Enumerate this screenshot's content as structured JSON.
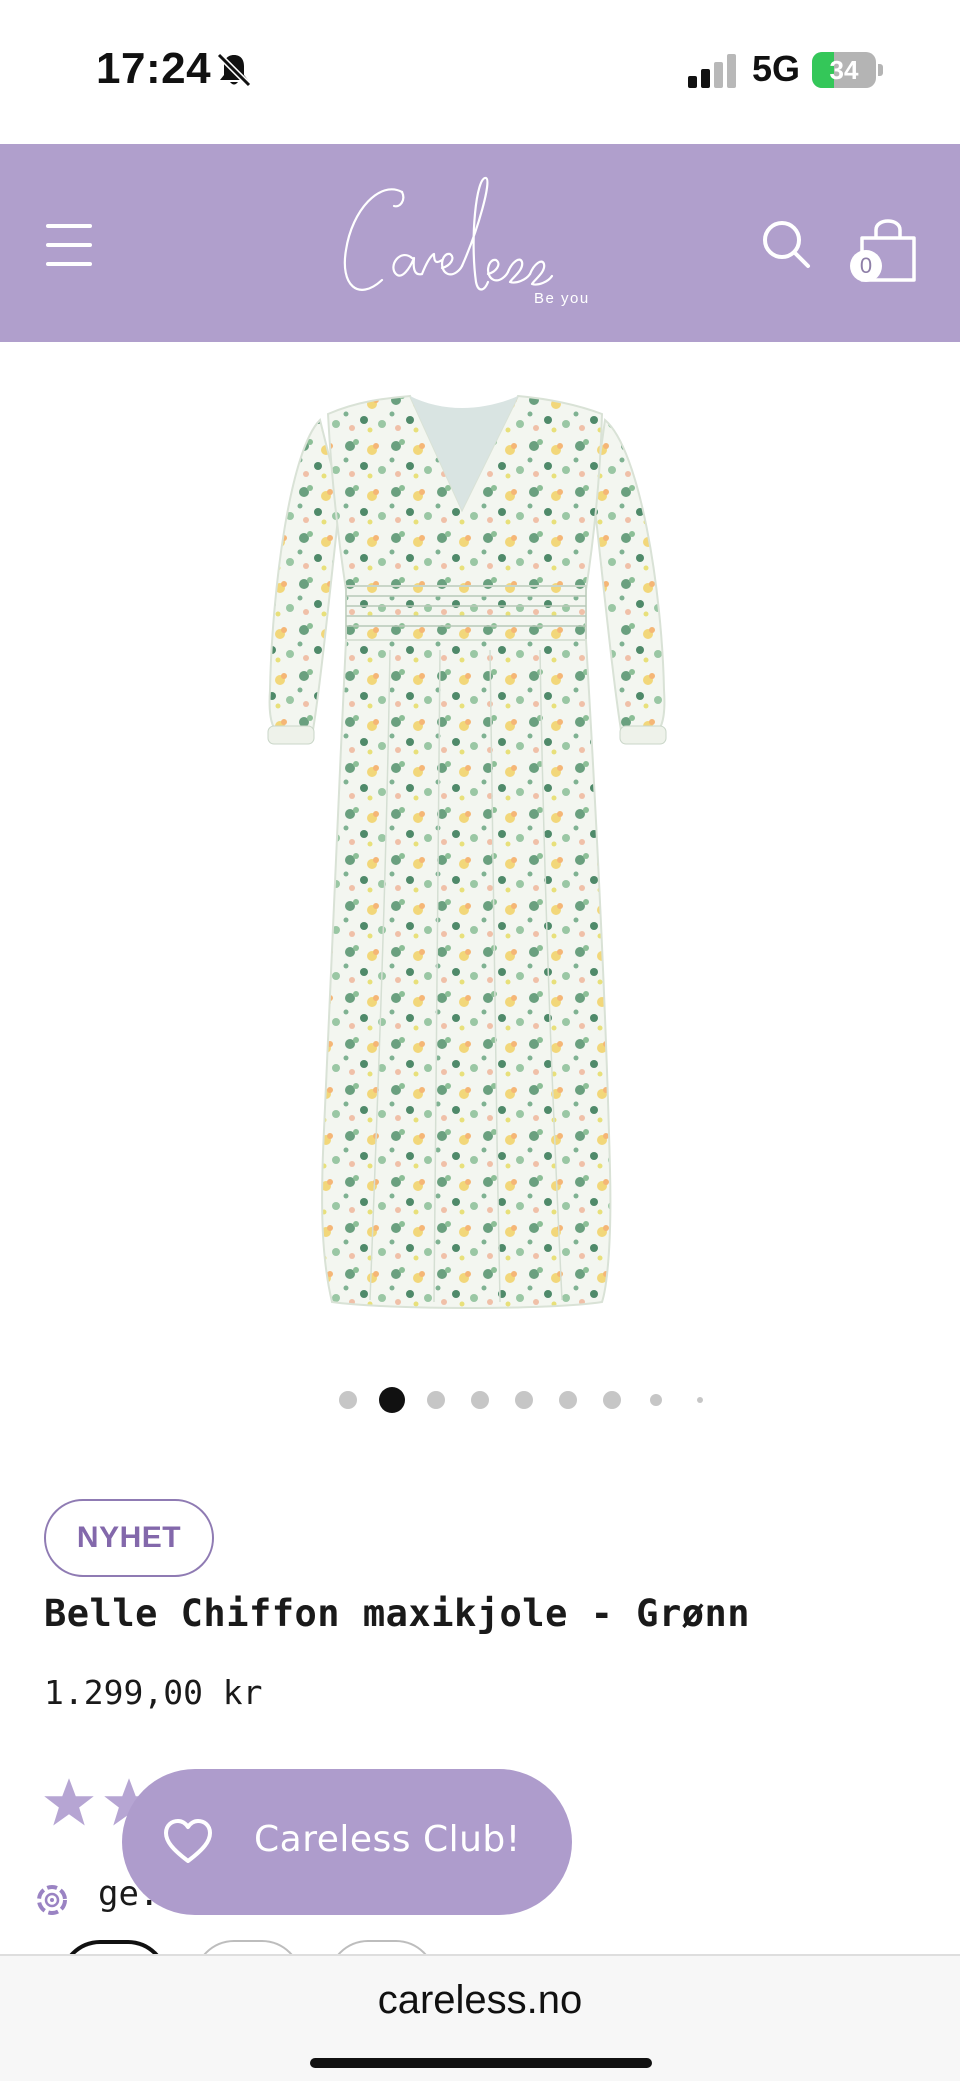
{
  "status_bar": {
    "time": "17:24",
    "network": "5G",
    "battery_percent": "34",
    "battery_level": 0.34,
    "signal_bars_filled": 2,
    "signal_bars_total": 4
  },
  "header": {
    "brand": "Careless",
    "tagline": "Be you",
    "background_color": "#b09fcc",
    "cart_count": "0"
  },
  "product": {
    "image_icon": "floral-maxi-dress-image",
    "badge": "NYHET",
    "title": "Belle Chiffon maxikjole - Grønn",
    "price": "1.299,00 kr",
    "carousel_dots_total": 9,
    "carousel_active_index": 1,
    "partial_text": "ge."
  },
  "club_button": {
    "label": "Careless Club!",
    "color": "#ae9ccc"
  },
  "browser": {
    "url": "careless.no"
  }
}
